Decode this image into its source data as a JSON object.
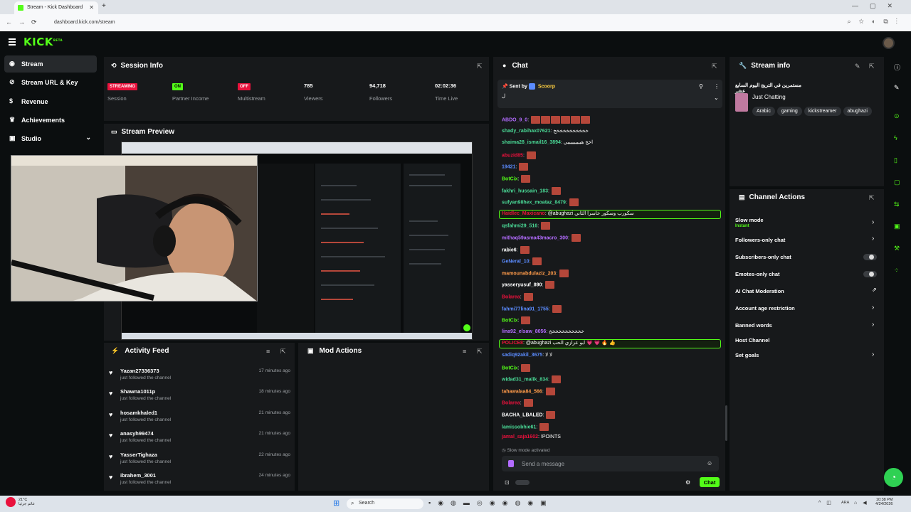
{
  "browser": {
    "tab_title": "Stream - Kick Dashboard",
    "tab_close": "✕",
    "new_tab": "+",
    "url": "dashboard.kick.com/stream"
  },
  "header": {
    "logo": "KICK",
    "logo_sup": "BETA"
  },
  "sidebar": {
    "items": [
      {
        "label": "Stream",
        "icon": "broadcast-icon"
      },
      {
        "label": "Stream URL & Key",
        "icon": "link-icon"
      },
      {
        "label": "Revenue",
        "icon": "dollar-icon"
      },
      {
        "label": "Achievements",
        "icon": "trophy-icon"
      },
      {
        "label": "Studio",
        "icon": "video-icon"
      }
    ]
  },
  "session_info": {
    "title": "Session Info",
    "columns": [
      {
        "value": "STREAMING",
        "label": "Session",
        "kind": "badge",
        "color": "#e9113c"
      },
      {
        "value": "ON",
        "label": "Partner Income",
        "kind": "badge",
        "color": "#53fc18"
      },
      {
        "value": "OFF",
        "label": "Multistream",
        "kind": "badge",
        "color": "#e9113c"
      },
      {
        "value": "785",
        "label": "Viewers",
        "kind": "stat"
      },
      {
        "value": "94,718",
        "label": "Followers",
        "kind": "stat"
      },
      {
        "value": "02:02:36",
        "label": "Time Live",
        "kind": "stat"
      }
    ]
  },
  "stream_preview": {
    "title": "Stream Preview"
  },
  "activity_feed": {
    "title": "Activity Feed",
    "items": [
      {
        "name": "Yazan27336373",
        "sub": "just followed the channel",
        "time": "17 minutes ago"
      },
      {
        "name": "Shawna1011p",
        "sub": "just followed the channel",
        "time": "18 minutes ago"
      },
      {
        "name": "hosamkhaled1",
        "sub": "just followed the channel",
        "time": "21 minutes ago"
      },
      {
        "name": "anasyh99474",
        "sub": "just followed the channel",
        "time": "21 minutes ago"
      },
      {
        "name": "YasserTighaza",
        "sub": "just followed the channel",
        "time": "22 minutes ago"
      },
      {
        "name": "ibrahem_3001",
        "sub": "just followed the channel",
        "time": "24 minutes ago"
      }
    ]
  },
  "mod_actions": {
    "title": "Mod Actions"
  },
  "chat": {
    "title": "Chat",
    "pinned": {
      "label": "Sent by",
      "user": "Scoorp",
      "message": "ل"
    },
    "messages": [
      {
        "user": "ABDO_9_0",
        "text": "",
        "color": "#b36cff",
        "emotes": 6
      },
      {
        "user": "shady_rabihax07621",
        "text": "خخخخخخخخخخخ",
        "color": "#4ad996",
        "emotes": 0
      },
      {
        "user": "shaima28_ismail16_3894",
        "text": "اخخ هيييييييييي",
        "color": "#4ad996",
        "emotes": 0
      },
      {
        "user": "abuzid85",
        "text": "",
        "color": "#e9113c",
        "emotes": 1
      },
      {
        "user": "19421",
        "text": "",
        "color": "#5b8cff",
        "emotes": 1
      },
      {
        "user": "BotCix",
        "text": "",
        "color": "#53fc18",
        "emotes": 1
      },
      {
        "user": "fakhri_hussain_183",
        "text": "",
        "color": "#4ad996",
        "emotes": 1
      },
      {
        "user": "sufyan98hex_moataz_8479",
        "text": "",
        "color": "#4ad996",
        "emotes": 1
      },
      {
        "user": "Haidlec_Maxicano",
        "text": "@abughazi سكورب وسكور خاسرا الثاني",
        "color": "#e9113c",
        "emotes": 0,
        "highlight": true
      },
      {
        "user": "qsfahmi29_516",
        "text": "",
        "color": "#4ad996",
        "emotes": 1
      },
      {
        "user": "mithaq59asma43macro_300",
        "text": "",
        "color": "#b36cff",
        "emotes": 1
      },
      {
        "user": "rabie6",
        "text": "",
        "color": "#ffffff",
        "emotes": 1
      },
      {
        "user": "GeNeral_10",
        "text": "",
        "color": "#5b8cff",
        "emotes": 1
      },
      {
        "user": "mamounabdulaziz_203",
        "text": "",
        "color": "#ff9b4a",
        "emotes": 1
      },
      {
        "user": "yasseryusuf_890",
        "text": "",
        "color": "#ffffff",
        "emotes": 1
      },
      {
        "user": "Bolarea",
        "text": "",
        "color": "#e9113c",
        "emotes": 1
      },
      {
        "user": "fahmi77lina91_1755",
        "text": "",
        "color": "#5b8cff",
        "emotes": 1
      },
      {
        "user": "BotCix",
        "text": "",
        "color": "#53fc18",
        "emotes": 1
      },
      {
        "user": "lina92_elsaw_8056",
        "text": "خخخخخخخخخخخ",
        "color": "#b36cff",
        "emotes": 0
      },
      {
        "user": "POLICE8",
        "text": "@abughazi ابو عزازي الحب 💗 💗 🔥 👍",
        "color": "#e9113c",
        "emotes": 0,
        "highlight": true
      },
      {
        "user": "sadiq92akil_3675",
        "text": "لا لا",
        "color": "#5b8cff",
        "emotes": 0
      },
      {
        "user": "BotCix",
        "text": "",
        "color": "#53fc18",
        "emotes": 1
      },
      {
        "user": "widad31_malik_834",
        "text": "",
        "color": "#4ad996",
        "emotes": 1
      },
      {
        "user": "tahawalaa84_566",
        "text": "",
        "color": "#ff9b4a",
        "emotes": 1
      },
      {
        "user": "Bolarea",
        "text": "",
        "color": "#e9113c",
        "emotes": 1
      },
      {
        "user": "BACHA_LBALED",
        "text": "",
        "color": "#ffffff",
        "emotes": 1
      },
      {
        "user": "lamissobhie61",
        "text": "",
        "color": "#4ad996",
        "emotes": 1
      },
      {
        "user": "jamal_saja1602",
        "text": "!POINTS",
        "color": "#e9113c",
        "emotes": 0
      }
    ],
    "slow_mode_notice": "Slow mode activated",
    "input_placeholder": "Send a message",
    "send_label": "Chat"
  },
  "stream_info": {
    "title": "Stream info",
    "stream_title": "مستمرين في التريج اليوم السابع عشر",
    "category": "Just Chatting",
    "tags": [
      "Arabic",
      "gaming",
      "kickstreamer",
      "abughazi"
    ]
  },
  "channel_actions": {
    "title": "Channel Actions",
    "items": [
      {
        "label": "Slow mode",
        "sub": "Instant",
        "control": "chevron"
      },
      {
        "label": "Followers-only chat",
        "control": "chevron"
      },
      {
        "label": "Subscribers-only chat",
        "control": "toggle"
      },
      {
        "label": "Emotes-only chat",
        "control": "toggle"
      },
      {
        "label": "AI Chat Moderation",
        "control": "external"
      },
      {
        "label": "Account age restriction",
        "control": "chevron"
      },
      {
        "label": "Banned words",
        "control": "chevron"
      },
      {
        "label": "Host Channel",
        "control": "none"
      },
      {
        "label": "Set goals",
        "control": "chevron"
      }
    ]
  },
  "taskbar": {
    "search": "Search",
    "weather_temp": "21°C",
    "weather_desc": "غائم جزئيا",
    "lang": "ARA",
    "time": "10:38 PM",
    "date": "4/24/2026"
  },
  "colors": {
    "accent": "#53fc18",
    "danger": "#e9113c",
    "panel": "#17191b",
    "background": "#0b0e0f"
  }
}
